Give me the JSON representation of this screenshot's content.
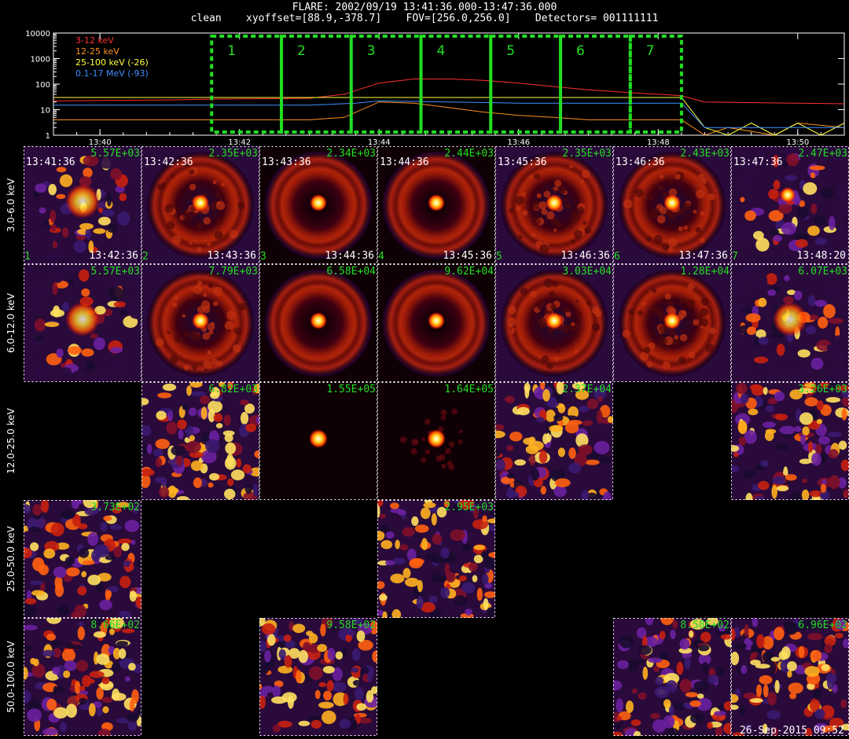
{
  "header": {
    "line1": "FLARE: 2002/09/19 13:41:36.000-13:47:36.000",
    "line2": "clean    xyoffset=[88.9,-378.7]    FOV=[256.0,256.0]    Detectors= 001111111"
  },
  "chart_data": [
    {
      "type": "line",
      "xlabel": "",
      "ylabel": "",
      "x_ticks": [
        "13:40",
        "13:42",
        "13:44",
        "13:46",
        "13:48",
        "13:50"
      ],
      "y_ticks": [
        "1",
        "10",
        "100",
        "1000",
        "10000"
      ],
      "y_scale": "log",
      "ylim": [
        1,
        10000
      ],
      "xlim": [
        "13:39:20",
        "13:50:40"
      ],
      "series": [
        {
          "name": "3-12 keV",
          "color": "#ff3030",
          "x": [
            "13:39:20",
            "13:40",
            "13:41",
            "13:41:40",
            "13:42:30",
            "13:43",
            "13:43:30",
            "13:44",
            "13:44:30",
            "13:45",
            "13:45:30",
            "13:46",
            "13:46:30",
            "13:47",
            "13:47:40",
            "13:48",
            "13:48:20",
            "13:48:40",
            "13:49:10",
            "13:50",
            "13:50:40"
          ],
          "y": [
            22,
            23,
            24,
            26,
            27,
            28,
            40,
            110,
            160,
            160,
            140,
            110,
            80,
            60,
            45,
            40,
            35,
            20,
            19,
            18,
            17
          ]
        },
        {
          "name": "12-25 keV",
          "color": "#ff9020",
          "x": [
            "13:39:20",
            "13:40",
            "13:41",
            "13:42",
            "13:43",
            "13:43:30",
            "13:44",
            "13:44:30",
            "13:45",
            "13:45:30",
            "13:46",
            "13:46:30",
            "13:47",
            "13:47:40",
            "13:48",
            "13:48:20",
            "13:48:40",
            "13:49",
            "13:49:40",
            "13:50",
            "13:50:40"
          ],
          "y": [
            4,
            4,
            4,
            4,
            4,
            5,
            20,
            18,
            12,
            8,
            6,
            5,
            4,
            4,
            4,
            4,
            1,
            2,
            1,
            3,
            2
          ]
        },
        {
          "name": "25-100 keV (-26)",
          "color": "#ffff40",
          "x": [
            "13:39:20",
            "13:40",
            "13:41",
            "13:42",
            "13:43",
            "13:44",
            "13:45",
            "13:46",
            "13:47",
            "13:48",
            "13:48:20",
            "13:48:40",
            "13:49",
            "13:49:20",
            "13:49:40",
            "13:50",
            "13:50:20",
            "13:50:40"
          ],
          "y": [
            30,
            30,
            30,
            30,
            30,
            30,
            30,
            30,
            30,
            30,
            30,
            2,
            1,
            3,
            1,
            3,
            1,
            3
          ]
        },
        {
          "name": "0.1-17 MeV (-93)",
          "color": "#4090ff",
          "x": [
            "13:39:20",
            "13:40",
            "13:41",
            "13:42",
            "13:43",
            "13:43:40",
            "13:44",
            "13:45",
            "13:46",
            "13:47",
            "13:48",
            "13:48:20",
            "13:48:40",
            "13:49",
            "13:49:30",
            "13:50",
            "13:50:40"
          ],
          "y": [
            15,
            15,
            15,
            15,
            15,
            18,
            22,
            20,
            18,
            18,
            18,
            18,
            2,
            2,
            2,
            2,
            2
          ]
        }
      ],
      "intervals": [
        {
          "label": "1",
          "start": "13:41:36",
          "end": "13:42:36"
        },
        {
          "label": "2",
          "start": "13:42:36",
          "end": "13:43:36"
        },
        {
          "label": "3",
          "start": "13:43:36",
          "end": "13:44:36"
        },
        {
          "label": "4",
          "start": "13:44:36",
          "end": "13:45:36"
        },
        {
          "label": "5",
          "start": "13:45:36",
          "end": "13:46:36"
        },
        {
          "label": "6",
          "start": "13:46:36",
          "end": "13:47:36"
        },
        {
          "label": "7",
          "start": "13:47:36",
          "end": "13:48:20"
        }
      ]
    },
    {
      "type": "heatmap",
      "energy_bands": [
        "3.0-6.0 keV",
        "6.0-12.0 keV",
        "12.0-25.0 keV",
        "25.0-50.0 keV",
        "50.0-100.0 keV"
      ],
      "columns": [
        {
          "index": "1",
          "start": "13:41:36",
          "end": "13:42:36"
        },
        {
          "index": "2",
          "start": "13:42:36",
          "end": "13:43:36"
        },
        {
          "index": "3",
          "start": "13:43:36",
          "end": "13:44:36"
        },
        {
          "index": "4",
          "start": "13:44:36",
          "end": "13:45:36"
        },
        {
          "index": "5",
          "start": "13:45:36",
          "end": "13:46:36"
        },
        {
          "index": "6",
          "start": "13:46:36",
          "end": "13:47:36"
        },
        {
          "index": "7",
          "start": "13:47:36",
          "end": "13:48:20"
        }
      ],
      "images": [
        {
          "row": 0,
          "col": 0,
          "peak": "5.57E+03",
          "style": "diffuse"
        },
        {
          "row": 0,
          "col": 1,
          "peak": "2.35E+03",
          "style": "ring_dim"
        },
        {
          "row": 0,
          "col": 2,
          "peak": "2.34E+03",
          "style": "ring"
        },
        {
          "row": 0,
          "col": 3,
          "peak": "2.44E+03",
          "style": "ring"
        },
        {
          "row": 0,
          "col": 4,
          "peak": "2.35E+03",
          "style": "ring_dim"
        },
        {
          "row": 0,
          "col": 5,
          "peak": "2.43E+03",
          "style": "ring_dim"
        },
        {
          "row": 0,
          "col": 6,
          "peak": "2.47E+03",
          "style": "patchy"
        },
        {
          "row": 1,
          "col": 0,
          "peak": "5.57E+03",
          "style": "diffuse"
        },
        {
          "row": 1,
          "col": 1,
          "peak": "7.79E+03",
          "style": "ring_dim"
        },
        {
          "row": 1,
          "col": 2,
          "peak": "6.58E+04",
          "style": "ring"
        },
        {
          "row": 1,
          "col": 3,
          "peak": "9.62E+04",
          "style": "ring"
        },
        {
          "row": 1,
          "col": 4,
          "peak": "3.03E+04",
          "style": "ring_dim"
        },
        {
          "row": 1,
          "col": 5,
          "peak": "1.28E+04",
          "style": "ring_dim"
        },
        {
          "row": 1,
          "col": 6,
          "peak": "6.07E+03",
          "style": "diffuse"
        },
        {
          "row": 2,
          "col": 1,
          "peak": "6.82E+03",
          "style": "noise"
        },
        {
          "row": 2,
          "col": 2,
          "peak": "1.55E+05",
          "style": "point"
        },
        {
          "row": 2,
          "col": 3,
          "peak": "1.64E+05",
          "style": "point_halo"
        },
        {
          "row": 2,
          "col": 4,
          "peak": "2.37E+04",
          "style": "noise"
        },
        {
          "row": 2,
          "col": 6,
          "peak": "3.26E+03",
          "style": "noise"
        },
        {
          "row": 3,
          "col": 0,
          "peak": "3.73E+02",
          "style": "noise"
        },
        {
          "row": 3,
          "col": 3,
          "peak": "2.95E+03",
          "style": "noise"
        },
        {
          "row": 4,
          "col": 0,
          "peak": "8.66E+02",
          "style": "noise"
        },
        {
          "row": 4,
          "col": 2,
          "peak": "9.58E+02",
          "style": "noise"
        },
        {
          "row": 4,
          "col": 5,
          "peak": "8.58E+02",
          "style": "noise"
        },
        {
          "row": 4,
          "col": 6,
          "peak": "6.96E+02",
          "style": "noise"
        }
      ]
    }
  ],
  "footer": {
    "stamp": "26-Sep-2015 09:52"
  },
  "colors": {
    "interval_box": "#22dd22",
    "label_green": "#22dd22",
    "background": "#000000"
  }
}
